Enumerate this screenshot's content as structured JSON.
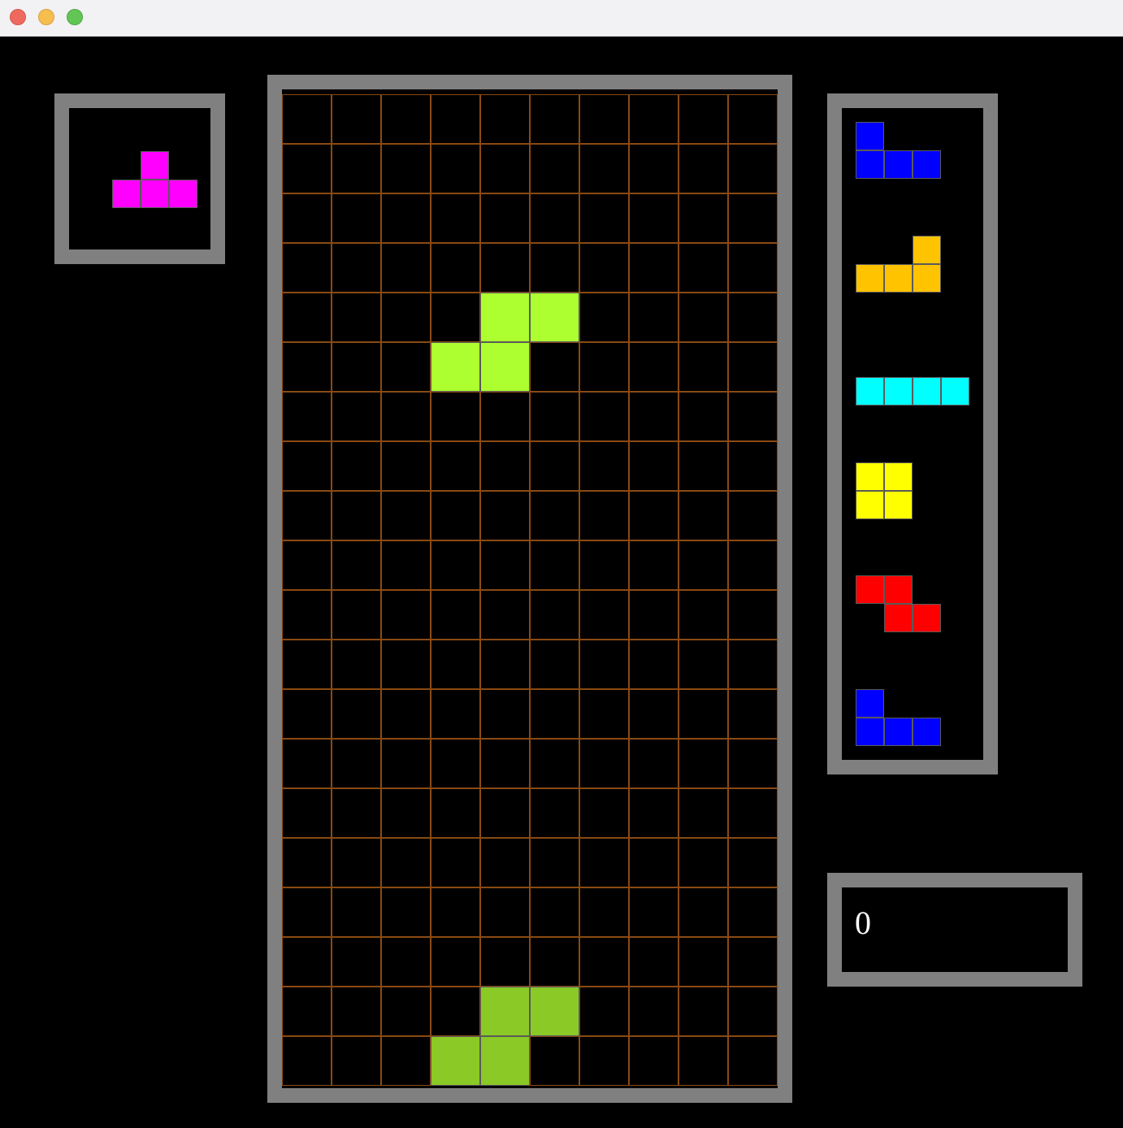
{
  "window": {
    "traffic_lights": [
      "close",
      "minimize",
      "zoom"
    ]
  },
  "colors": {
    "background": "#000000",
    "panel_border": "#808080",
    "grid_line": "#8b4a12",
    "score_text": "#ffffff"
  },
  "board": {
    "cols": 10,
    "rows": 20,
    "active_piece": {
      "type": "S",
      "color": "#adff2f",
      "cells": [
        [
          4,
          4
        ],
        [
          5,
          4
        ],
        [
          3,
          5
        ],
        [
          4,
          5
        ]
      ]
    },
    "settled_blocks": {
      "color": "#8ac926",
      "cells": [
        [
          4,
          18
        ],
        [
          5,
          18
        ],
        [
          3,
          19
        ],
        [
          4,
          19
        ]
      ]
    }
  },
  "hold": {
    "piece": {
      "type": "T",
      "color": "#ff00ff",
      "cells": [
        [
          1,
          0
        ],
        [
          0,
          1
        ],
        [
          1,
          1
        ],
        [
          2,
          1
        ]
      ]
    }
  },
  "next_queue": [
    {
      "type": "J",
      "color": "#0000ff",
      "cells": [
        [
          0,
          0
        ],
        [
          0,
          1
        ],
        [
          1,
          1
        ],
        [
          2,
          1
        ]
      ]
    },
    {
      "type": "L",
      "color": "#ffc300",
      "cells": [
        [
          2,
          0
        ],
        [
          0,
          1
        ],
        [
          1,
          1
        ],
        [
          2,
          1
        ]
      ]
    },
    {
      "type": "I",
      "color": "#00ffff",
      "cells": [
        [
          0,
          1
        ],
        [
          1,
          1
        ],
        [
          2,
          1
        ],
        [
          3,
          1
        ]
      ]
    },
    {
      "type": "O",
      "color": "#ffff00",
      "cells": [
        [
          0,
          0
        ],
        [
          1,
          0
        ],
        [
          0,
          1
        ],
        [
          1,
          1
        ]
      ]
    },
    {
      "type": "Z",
      "color": "#ff0000",
      "cells": [
        [
          0,
          0
        ],
        [
          1,
          0
        ],
        [
          1,
          1
        ],
        [
          2,
          1
        ]
      ]
    },
    {
      "type": "J",
      "color": "#0000ff",
      "cells": [
        [
          0,
          0
        ],
        [
          0,
          1
        ],
        [
          1,
          1
        ],
        [
          2,
          1
        ]
      ]
    }
  ],
  "score": {
    "value": "0"
  }
}
